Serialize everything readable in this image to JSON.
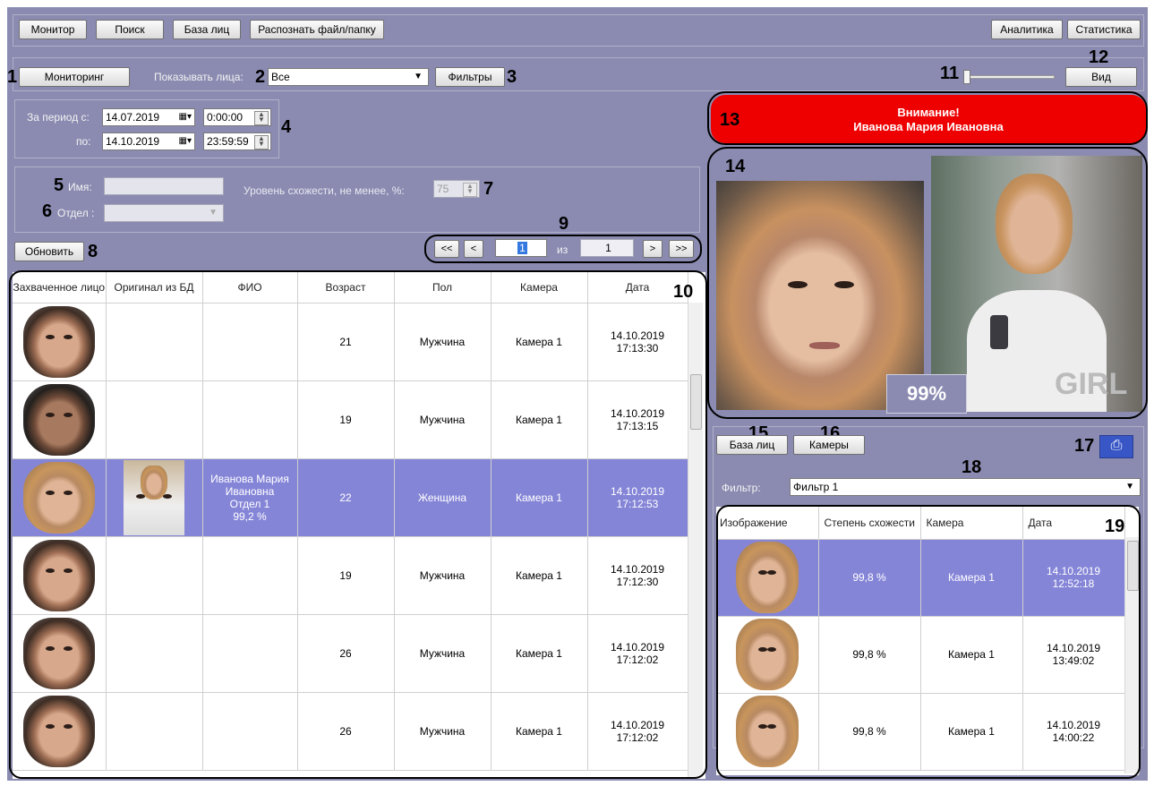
{
  "toolbar": {
    "monitor": "Монитор",
    "search": "Поиск",
    "face_db": "База лиц",
    "recognize": "Распознать файл/папку",
    "analytics": "Аналитика",
    "statistics": "Статистика"
  },
  "row2": {
    "monitoring": "Мониторинг",
    "show_faces_label": "Показывать лица:",
    "show_faces_value": "Все",
    "filters": "Фильтры",
    "view": "Вид"
  },
  "period": {
    "from_label": "За период с:",
    "to_label": "по:",
    "from_date": "14.07.2019",
    "from_time": "0:00:00",
    "to_date": "14.10.2019",
    "to_time": "23:59:59"
  },
  "search_form": {
    "name_label": "Имя:",
    "dept_label": "Отдел :",
    "similarity_label": "Уровень схожести, не менее, %:",
    "similarity_value": "75"
  },
  "refresh": "Обновить",
  "pager": {
    "first": "<<",
    "prev": "<",
    "page": "1",
    "of": "из",
    "total": "1",
    "next": ">",
    "last": ">>"
  },
  "main_table": {
    "headers": [
      "Захваченное лицо",
      "Оригинал из БД",
      "ФИО",
      "Возраст",
      "Пол",
      "Камера",
      "Дата"
    ],
    "rows": [
      {
        "age": "21",
        "sex": "Мужчина",
        "camera": "Камера 1",
        "date": "14.10.2019\n17:13:30",
        "face": "male"
      },
      {
        "age": "19",
        "sex": "Мужчина",
        "camera": "Камера 1",
        "date": "14.10.2019\n17:13:15",
        "face": "dark"
      },
      {
        "name_line1": "Иванова Мария",
        "name_line2": "Ивановна",
        "name_line3": "Отдел 1",
        "name_line4": "99,2 %",
        "age": "22",
        "sex": "Женщина",
        "camera": "Камера 1",
        "date": "14.10.2019\n17:12:53",
        "face": "female",
        "selected": true
      },
      {
        "age": "19",
        "sex": "Мужчина",
        "camera": "Камера 1",
        "date": "14.10.2019\n17:12:30",
        "face": "male"
      },
      {
        "age": "26",
        "sex": "Мужчина",
        "camera": "Камера 1",
        "date": "14.10.2019\n17:12:02",
        "face": "male"
      },
      {
        "age": "26",
        "sex": "Мужчина",
        "camera": "Камера 1",
        "date": "14.10.2019\n17:12:02",
        "face": "male"
      }
    ]
  },
  "alert": {
    "line1": "Внимание!",
    "line2": "Иванова Мария Ивановна",
    "color": "#ee0000"
  },
  "match": {
    "percent": "99%",
    "shirt_text": "GIRL"
  },
  "right_buttons": {
    "face_db": "База лиц",
    "cameras": "Камеры"
  },
  "filter": {
    "label": "Фильтр:",
    "value": "Фильтр 1"
  },
  "right_table": {
    "headers": [
      "Изображение",
      "Степень схожести",
      "Камера",
      "Дата"
    ],
    "rows": [
      {
        "similarity": "99,8 %",
        "camera": "Камера 1",
        "date": "14.10.2019\n12:52:18",
        "selected": true
      },
      {
        "similarity": "99,8 %",
        "camera": "Камера 1",
        "date": "14.10.2019\n13:49:02"
      },
      {
        "similarity": "99,8 %",
        "camera": "Камера 1",
        "date": "14.10.2019\n14:00:22"
      }
    ]
  },
  "callouts": [
    "1",
    "2",
    "3",
    "4",
    "5",
    "6",
    "7",
    "8",
    "9",
    "10",
    "11",
    "12",
    "13",
    "14",
    "15",
    "16",
    "17",
    "18",
    "19"
  ],
  "colors": {
    "background": "#8b8bb2",
    "selected_row": "#8585d8",
    "alert": "#ee0000"
  }
}
